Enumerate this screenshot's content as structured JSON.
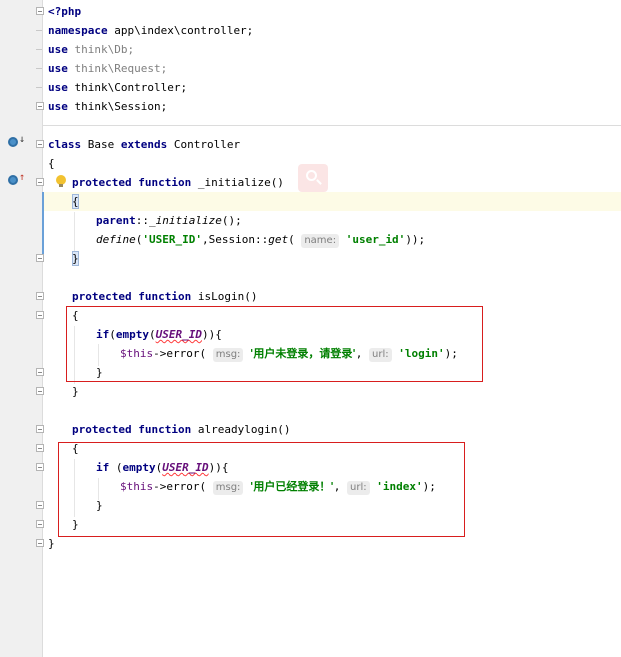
{
  "editor": {
    "lines": {
      "php_open": "<?php",
      "namespace_kw": "namespace",
      "namespace_val": " app\\index\\controller;",
      "use_kw": "use",
      "use1": " think\\Db;",
      "use2": " think\\Request;",
      "use3": " think\\Controller;",
      "use4": " think\\Session;",
      "class_kw": "class",
      "class_name": " Base ",
      "extends_kw": "extends",
      "class_parent": " Controller",
      "brace_open": "{",
      "brace_close": "}",
      "protected_kw": "protected",
      "function_kw": "function",
      "fn_initialize": " _initialize()",
      "parent_kw": "parent",
      "parent_call": "::",
      "parent_method": "_initialize",
      "parent_tail": "();",
      "define_fn": "define",
      "define_open": "(",
      "define_str": "'USER_ID'",
      "define_mid": ",Session::",
      "get_fn": "get",
      "get_open": "(",
      "name_hint": "name:",
      "define_str2": "'user_id'",
      "define_tail": "));",
      "fn_islogin": " isLogin()",
      "if_kw": "if",
      "empty_kw": "empty",
      "if_open": "(",
      "empty_open": "(",
      "const_user_id": "USER_ID",
      "if_tail": ")){",
      "this_var": "$this",
      "arrow": "->",
      "error_fn": "error",
      "err_open": "(",
      "msg_hint": "msg:",
      "msg1": "'用户未登录，请登录'",
      "comma": ",",
      "url_hint": "url:",
      "url1": "'login'",
      "err_tail": ");",
      "fn_alreadylogin": " alreadylogin()",
      "if_space": " (",
      "msg2": "'用户已经登录！'",
      "url2": "'index'"
    }
  },
  "colors": {
    "keyword": "#000080",
    "string": "#008000",
    "constant": "#660e7a",
    "highlight_box": "#d81e1e"
  },
  "icons": {
    "method_override": "override-method-icon",
    "method_implement": "implement-method-icon",
    "intention": "lightbulb-icon",
    "search": "search-icon"
  }
}
